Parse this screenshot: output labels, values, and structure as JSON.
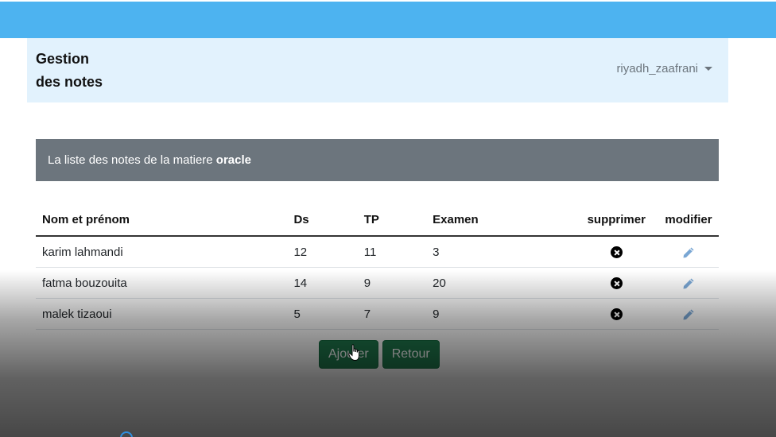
{
  "header": {
    "brand_line1": "Gestion",
    "brand_line2": "des notes",
    "user_name": "riyadh_zaafrani"
  },
  "banner": {
    "prefix": "La liste des notes de la matiere ",
    "subject": "oracle"
  },
  "table": {
    "columns": {
      "name": "Nom et prénom",
      "ds": "Ds",
      "tp": "TP",
      "exam": "Examen",
      "delete": "supprimer",
      "edit": "modifier"
    },
    "rows": [
      {
        "name": "karim lahmandi",
        "ds": "12",
        "tp": "11",
        "exam": "3"
      },
      {
        "name": "fatma bouzouita",
        "ds": "14",
        "tp": "9",
        "exam": "20"
      },
      {
        "name": "malek tizaoui",
        "ds": "5",
        "tp": "7",
        "exam": "9"
      }
    ]
  },
  "actions": {
    "add_label": "Ajouter",
    "back_label": "Retour"
  },
  "icons": {
    "delete": "close-circle-icon",
    "edit": "pencil-icon",
    "user_menu": "caret-down-icon"
  },
  "colors": {
    "topbar": "#4db3f0",
    "navbar": "#e2f2fd",
    "banner": "#6c757d",
    "button": "#1f7a4d",
    "edit_icon": "#7aa7d4"
  }
}
